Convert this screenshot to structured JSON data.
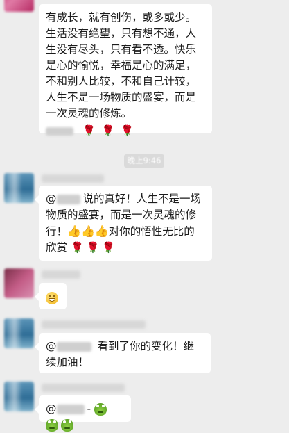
{
  "messages": [
    {
      "id": "m1",
      "text": "有成长，就有创伤，或多或少。生活没有绝望，只有想不通，人生没有尽头，只有看不透。快乐是心的愉悦，幸福是心的满足，不和别人比较，不和自己计较，人生不是一场物质的盛宴，而是一次灵魂的修炼。",
      "footer_emoji": [
        "rose",
        "rose",
        "rose"
      ]
    },
    {
      "id": "m2",
      "mention_prefix": "@",
      "text": "说的真好！人生不是一场物质的盛宴，而是一次灵魂的修行！",
      "tail_text": "对你的悟性无比的欣赏",
      "inline_emoji": [
        "thumbs-up",
        "thumbs-up",
        "thumbs-up"
      ],
      "footer_emoji": [
        "rose",
        "rose",
        "rose"
      ]
    },
    {
      "id": "m3",
      "emoji": "grin"
    },
    {
      "id": "m4",
      "mention_prefix": "@",
      "text": "看到了你的变化！继续加油！"
    },
    {
      "id": "m5",
      "mention_prefix": "@",
      "separator": "-",
      "emoji": [
        "frog",
        "frog",
        "frog"
      ]
    }
  ],
  "timestamp": "晚上9:46",
  "colors": {
    "background": "#ededed",
    "bubble": "#ffffff",
    "text": "#1c1c1c",
    "rose": "#c9283b"
  }
}
